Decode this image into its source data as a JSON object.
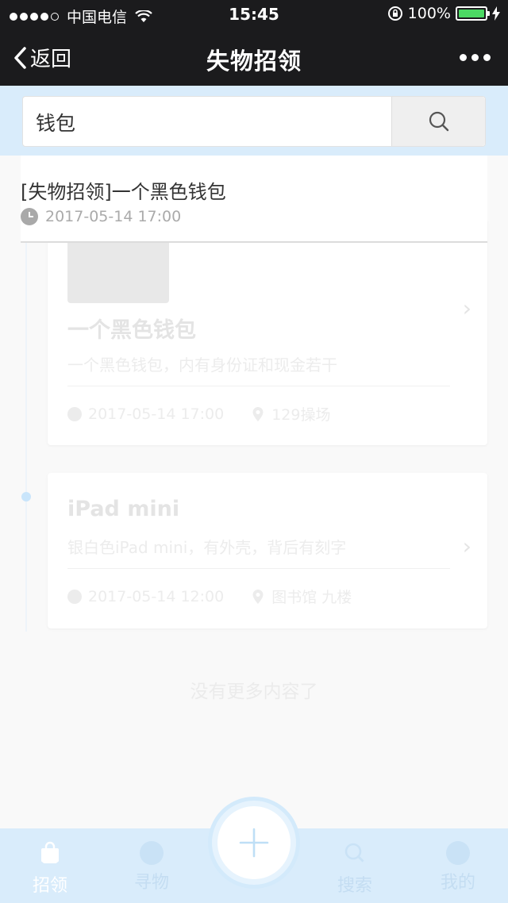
{
  "status_bar": {
    "carrier": "中国电信",
    "time": "15:45",
    "battery_percent": "100%",
    "battery_level": 1.0
  },
  "nav": {
    "back_label": "返回",
    "title": "失物招领"
  },
  "search": {
    "value": "钱包",
    "button_icon": "search-icon"
  },
  "result": {
    "title": "[失物招领]一个黑色钱包",
    "time": "2017-05-14 17:00"
  },
  "cards": [
    {
      "title": "一个黑色钱包",
      "description": "一个黑色钱包，内有身份证和现金若干",
      "time": "2017-05-14 17:00",
      "location": "129操场"
    },
    {
      "title": "iPad mini",
      "description": "银白色iPad mini，有外壳，背后有刻字",
      "time": "2017-05-14 12:00",
      "location": "图书馆 九楼"
    }
  ],
  "no_more": "没有更多内容了",
  "tabs": [
    {
      "label": "招领",
      "icon": "bag-icon",
      "active": true
    },
    {
      "label": "寻物",
      "icon": "eye-icon",
      "active": false
    },
    {
      "label": "搜索",
      "icon": "search-icon",
      "active": false
    },
    {
      "label": "我的",
      "icon": "smile-icon",
      "active": false
    }
  ],
  "fab_icon": "plus-icon",
  "colors": {
    "nav_bg": "#1b1b1d",
    "accent_light": "#d9ecfb",
    "battery": "#4cd964"
  }
}
